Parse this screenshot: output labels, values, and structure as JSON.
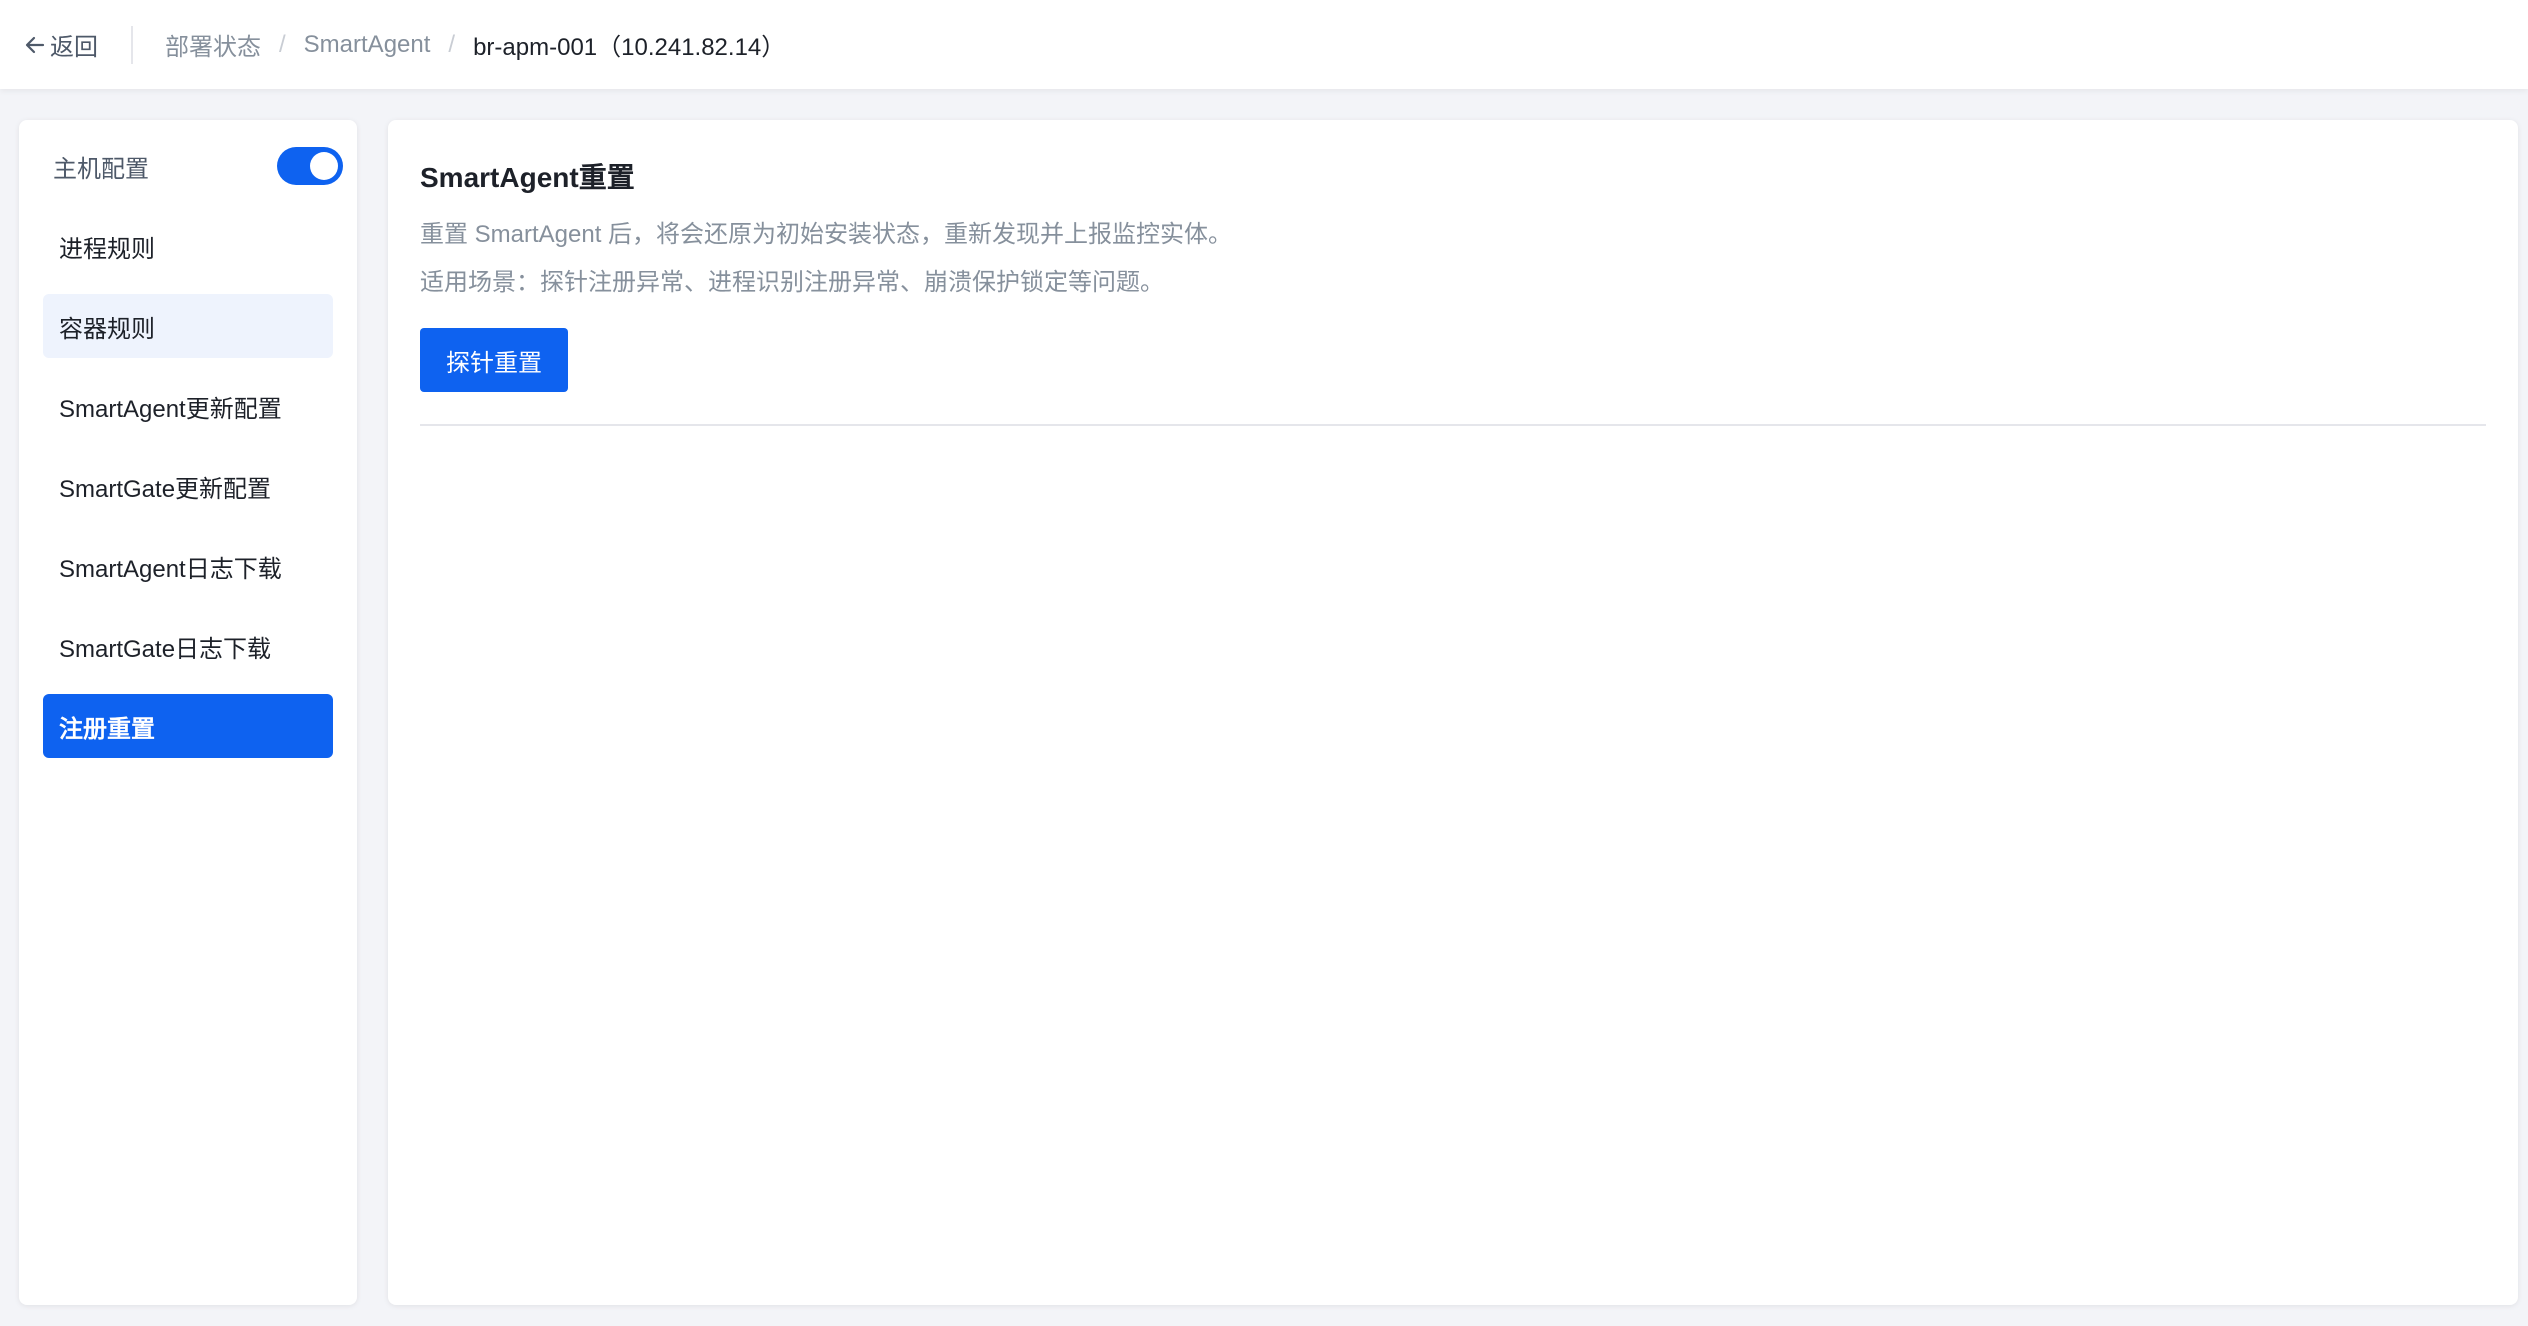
{
  "header": {
    "back_label": "返回",
    "breadcrumb": {
      "items": [
        "部署状态",
        "SmartAgent"
      ],
      "current": "br-apm-001（10.241.82.14）",
      "separator": "/"
    }
  },
  "sidebar": {
    "header_label": "主机配置",
    "toggle_on": true,
    "items": [
      {
        "label": "进程规则",
        "state": "normal"
      },
      {
        "label": "容器规则",
        "state": "hover"
      },
      {
        "label": "SmartAgent更新配置",
        "state": "normal"
      },
      {
        "label": "SmartGate更新配置",
        "state": "normal"
      },
      {
        "label": "SmartAgent日志下载",
        "state": "normal"
      },
      {
        "label": "SmartGate日志下载",
        "state": "normal"
      },
      {
        "label": "注册重置",
        "state": "active"
      }
    ]
  },
  "main": {
    "title": "SmartAgent重置",
    "description_line1": "重置 SmartAgent 后，将会还原为初始安装状态，重新发现并上报监控实体。",
    "description_line2": "适用场景：探针注册异常、进程识别注册异常、崩溃保护锁定等问题。",
    "reset_button_label": "探针重置"
  },
  "colors": {
    "primary": "#0e62f0",
    "hover_bg": "#eef3fd",
    "page_bg": "#f3f4f8",
    "text_secondary": "#86909c"
  }
}
